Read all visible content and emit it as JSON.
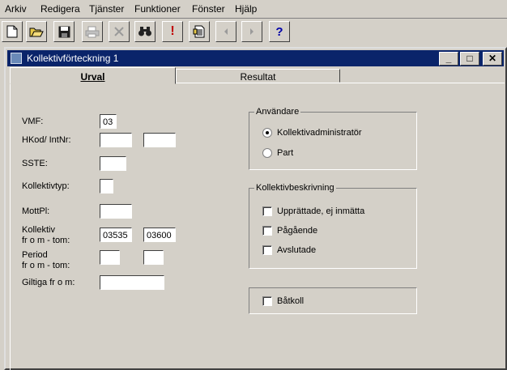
{
  "menu": [
    "Arkiv",
    "Redigera",
    "Tjänster",
    "Funktioner",
    "Fönster",
    "Hjälp"
  ],
  "window": {
    "title": "Kollektivförteckning 1"
  },
  "tabs": [
    {
      "label": "Urval",
      "active": true
    },
    {
      "label": "Resultat",
      "active": false
    }
  ],
  "form": {
    "vmf_label": "VMF:",
    "vmf_value": "03",
    "hkod_label": "HKod/ IntNr:",
    "hkod_value": "",
    "intnr_value": "",
    "sste_label": "SSTE:",
    "sste_value": "",
    "kollektivtyp_label": "Kollektivtyp:",
    "kollektivtyp_value": "",
    "mottpl_label": "MottPl:",
    "mottpl_value": "",
    "kollektiv_label_1": "Kollektiv",
    "kollektiv_label_2": "fr o m - tom:",
    "kollektiv_from": "03535",
    "kollektiv_to": "03600",
    "period_label_1": "Period",
    "period_label_2": "fr o m - tom:",
    "period_from": "",
    "period_to": "",
    "giltiga_label": "Giltiga fr o m:",
    "giltiga_value": ""
  },
  "anvandare": {
    "legend": "Användare",
    "options": [
      {
        "label": "Kollektivadministratör",
        "selected": true
      },
      {
        "label": "Part",
        "selected": false
      }
    ]
  },
  "beskrivning": {
    "legend": "Kollektivbeskrivning",
    "options": [
      {
        "label": "Upprättade, ej inmätta",
        "checked": false
      },
      {
        "label": "Pågående",
        "checked": false
      },
      {
        "label": "Avslutade",
        "checked": false
      }
    ]
  },
  "batkoll": {
    "label": "Båtkoll",
    "checked": false
  },
  "colors": {
    "titlebar": "#0a246a",
    "face": "#d4d0c8"
  }
}
